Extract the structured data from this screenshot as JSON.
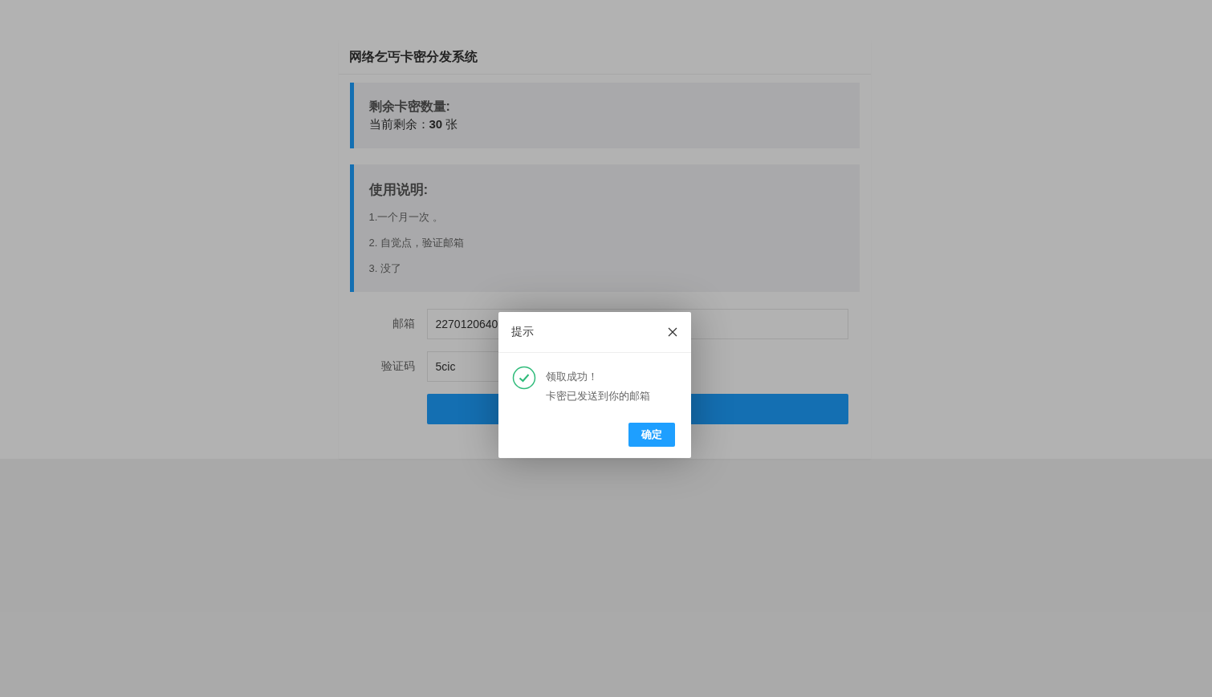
{
  "panel": {
    "title": "网络乞丐卡密分发系统"
  },
  "stock": {
    "heading": "剩余卡密数量:",
    "line": "当前剩余：**30** 张"
  },
  "instructions": {
    "heading": "使用说明:",
    "items": [
      "1.一个月一次 。",
      "2. 自觉点，验证邮箱",
      "3. 没了"
    ]
  },
  "form": {
    "fields": [
      {
        "label": "邮箱",
        "value": "2270120640"
      },
      {
        "label": "验证码",
        "value": "5cic"
      }
    ]
  },
  "dialog": {
    "title": "提示",
    "messages": [
      "领取成功！",
      "卡密已发送到你的邮箱"
    ],
    "confirm": "确定"
  }
}
